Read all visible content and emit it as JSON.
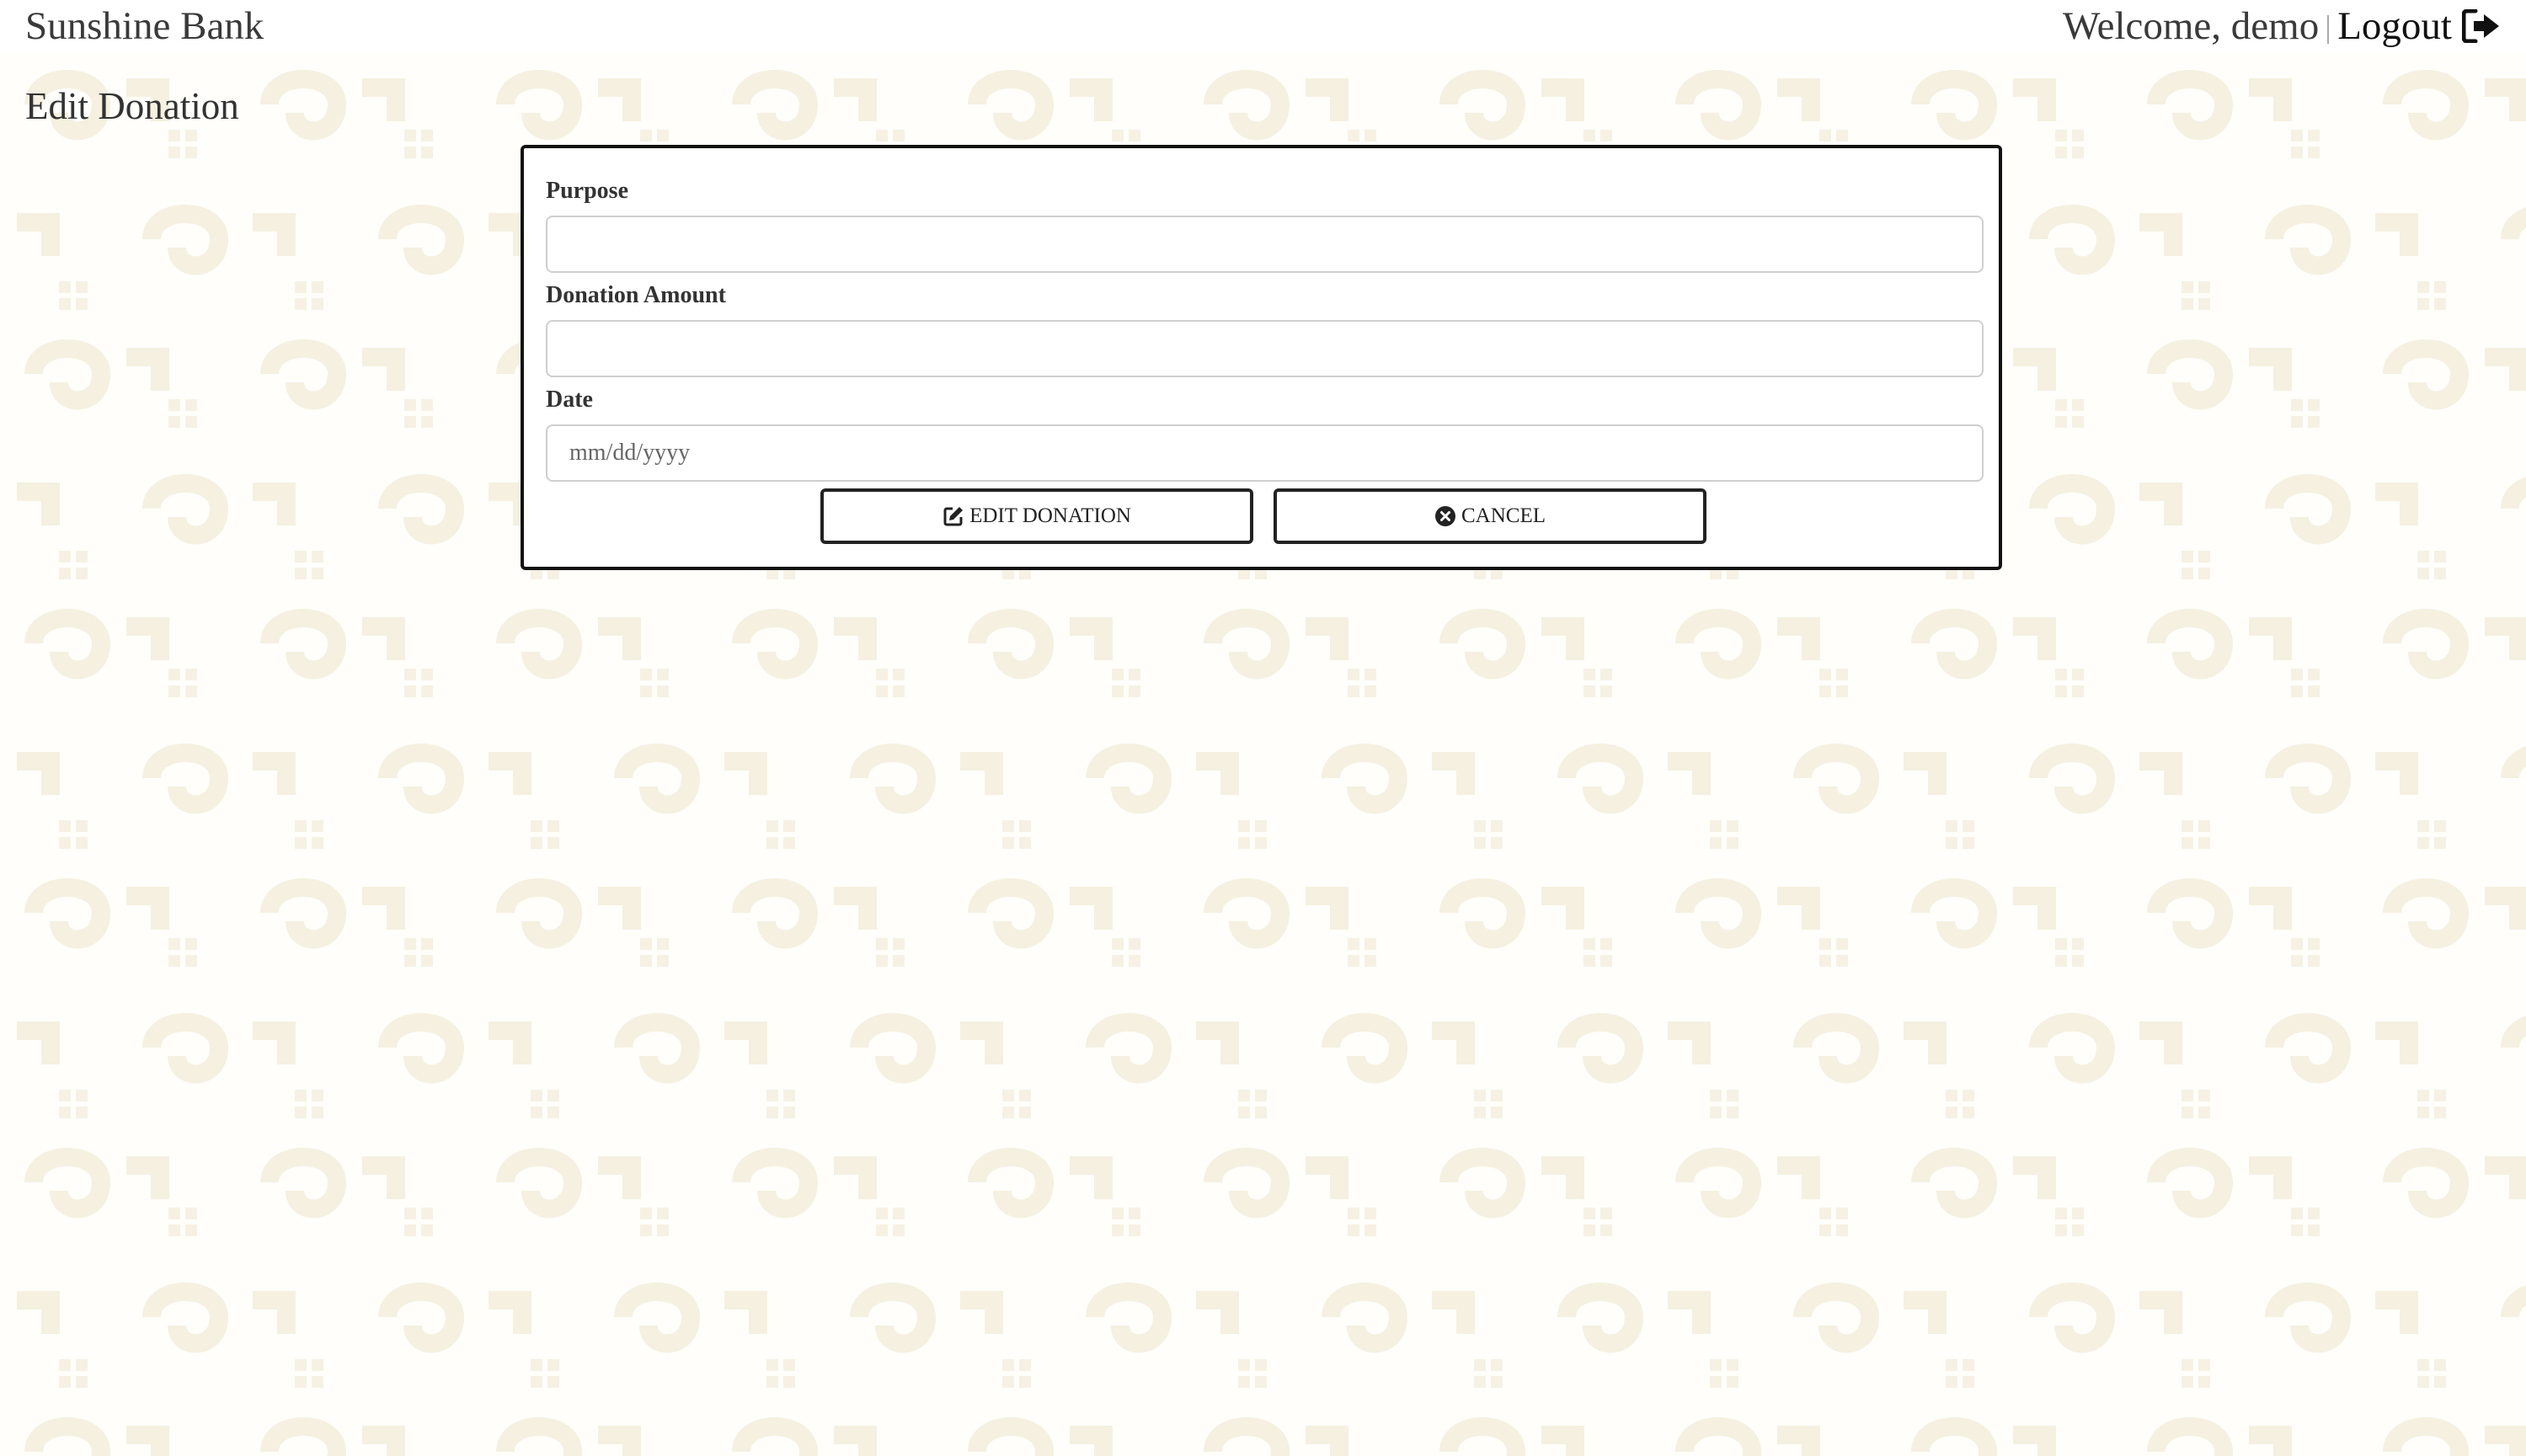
{
  "header": {
    "brand": "Sunshine Bank",
    "welcome": "Welcome, demo",
    "logout_label": "Logout",
    "logout_icon": "sign-out-icon"
  },
  "page": {
    "title": "Edit Donation"
  },
  "form": {
    "purpose": {
      "label": "Purpose",
      "value": "",
      "placeholder": ""
    },
    "amount": {
      "label": "Donation Amount",
      "value": "",
      "placeholder": ""
    },
    "date": {
      "label": "Date",
      "value": "",
      "placeholder": "mm/dd/yyyy"
    },
    "submit": {
      "label": "EDIT DONATION",
      "icon": "edit-icon"
    },
    "cancel": {
      "label": "CANCEL",
      "icon": "times-circle-icon"
    }
  },
  "colors": {
    "background": "#fffefb",
    "pattern": "#f4efdf",
    "border": "#111111"
  }
}
